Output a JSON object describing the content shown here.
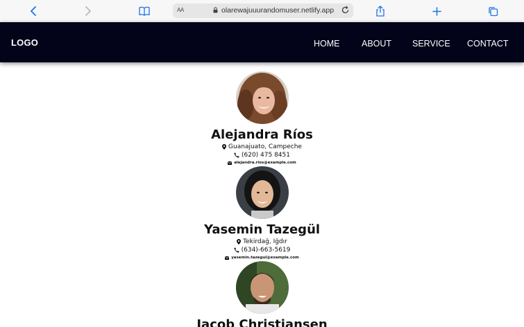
{
  "browser": {
    "url": "olarewajuuurandomuser.netlify.app",
    "aa_label": "AA"
  },
  "site": {
    "logo": "LOGO",
    "nav": [
      {
        "label": "HOME"
      },
      {
        "label": "ABOUT"
      },
      {
        "label": "SERVICE"
      },
      {
        "label": "CONTACT"
      }
    ]
  },
  "users": [
    {
      "name": "Alejandra Ríos",
      "location": "Guanajuato, Campeche",
      "phone": "(620) 475 8451",
      "email": "alejandra.rios@example.com"
    },
    {
      "name": "Yasemin Tazegül",
      "location": "Tekirdağ, Iğdır",
      "phone": "(634)-663-5619",
      "email": "yasemin.tazegul@example.com"
    },
    {
      "name": "Jacob Christiansen",
      "location": "",
      "phone": "",
      "email": ""
    }
  ],
  "colors": {
    "navbar_bg": "#03031a",
    "toolbar_icon": "#1a73e8"
  }
}
